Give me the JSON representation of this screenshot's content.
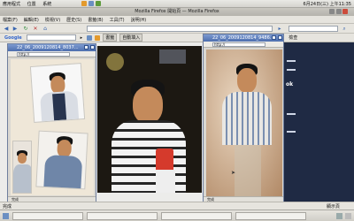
{
  "top_panel": {
    "menus": [
      "應用程式",
      "位置",
      "系統"
    ],
    "clock": "6月24日(三) 上午11:35"
  },
  "firefox": {
    "title": "Mozilla Firefox 開始頁 — Mozilla Firefox",
    "menubar": [
      "檔案(F)",
      "編輯(E)",
      "檢視(V)",
      "歷史(S)",
      "書籤(B)",
      "工具(T)",
      "說明(H)"
    ],
    "nav_buttons": [
      "back",
      "forward",
      "reload",
      "stop",
      "home"
    ],
    "toolbar2": {
      "google_label": "Google",
      "items": [
        "書籤",
        "自動填入"
      ],
      "check_label": "檢查"
    }
  },
  "popup1": {
    "title": "22_06_2009120814_8037...",
    "url": "http://",
    "status": "完成"
  },
  "popup2": {
    "title": "22_06_2009120814_9486...",
    "url": "http://",
    "status": "完成"
  },
  "main_photo_caption": "",
  "bottom_status": {
    "left": "完成",
    "right": "顯示頁"
  },
  "taskbar": {
    "tasks": [
      "",
      "",
      "",
      ""
    ]
  }
}
